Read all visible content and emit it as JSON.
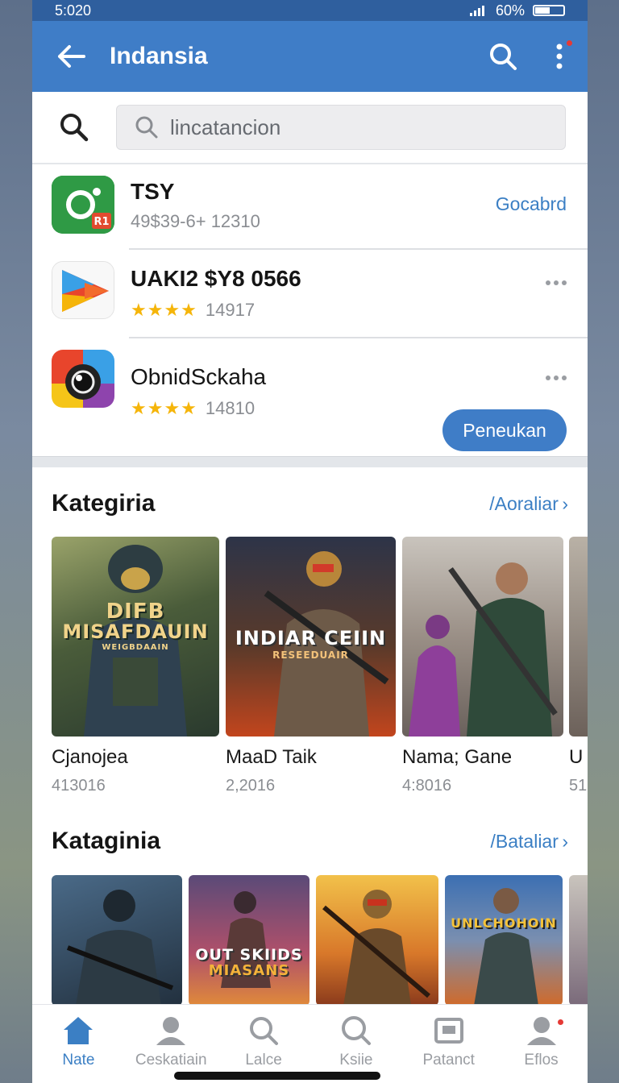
{
  "status": {
    "time": "5:020",
    "battery": "60%"
  },
  "appbar": {
    "title": "Indansia"
  },
  "search": {
    "placeholder": "lincatancion"
  },
  "apps": [
    {
      "name": "TSY",
      "sub": "49$39-6+ 12310",
      "action": "Gocabrd",
      "icon": "green-app-icon"
    },
    {
      "name": "UAKI2 $Y8 0566",
      "stars": "★★★★",
      "rating": "14917",
      "icon": "play-store-icon"
    },
    {
      "name": "ObnidSckaha",
      "stars": "★★★★",
      "rating": "14810",
      "icon": "camera-app-icon"
    }
  ],
  "install_button": "Peneukan",
  "section1": {
    "title": "Kategiria",
    "see_all": "/Aoraliar",
    "cards": [
      {
        "name": "Cjanojea",
        "count": "413016",
        "art_line1": "DIFB",
        "art_line2": "MISAFDAUIN",
        "art_line3": "WEIGBDAAIN"
      },
      {
        "name": "MaaD Taik",
        "count": "2,2016",
        "art_line1": "INDIAR CEIIN",
        "art_line2": "RESEEDUAIR"
      },
      {
        "name": "Nama; Gane",
        "count": "4:8016"
      },
      {
        "name": "U",
        "count": "51"
      }
    ]
  },
  "section2": {
    "title": "Kataginia",
    "see_all": "/Bataliar",
    "cards": [
      {
        "art": ""
      },
      {
        "art_line1": "OUT SKIIDS",
        "art_line2": "MIASANS"
      },
      {
        "art": ""
      },
      {
        "art_line1": "UNLCHOHOIN"
      }
    ]
  },
  "nav": [
    {
      "label": "Nate",
      "icon": "home-icon"
    },
    {
      "label": "Ceskatiain",
      "icon": "person-icon"
    },
    {
      "label": "Lalce",
      "icon": "search-icon"
    },
    {
      "label": "Ksiie",
      "icon": "search-icon"
    },
    {
      "label": "Patanct",
      "icon": "image-icon"
    },
    {
      "label": "Eflos",
      "icon": "profile-icon"
    }
  ],
  "colors": {
    "appbar": "#3f7dc7",
    "accent": "#3b7fc4",
    "star": "#f5b50a"
  }
}
